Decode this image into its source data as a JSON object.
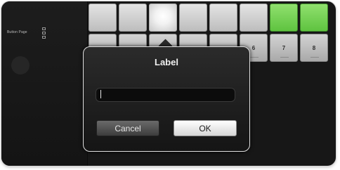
{
  "sidebar": {
    "label": "Button Page"
  },
  "grid": {
    "top_row": [
      "",
      "",
      "",
      "",
      "",
      "",
      "",
      ""
    ],
    "bottom_row_visible": [
      "6",
      "7",
      "8"
    ]
  },
  "dialog": {
    "title": "Label",
    "input_value": "",
    "cancel_label": "Cancel",
    "ok_label": "OK"
  },
  "colors": {
    "pad_white": "#d9d9d9",
    "pad_green": "#7ad557",
    "dialog_bg": "#1f1f1f",
    "ok_button": "#f0f0f0",
    "cancel_button": "#555555"
  }
}
